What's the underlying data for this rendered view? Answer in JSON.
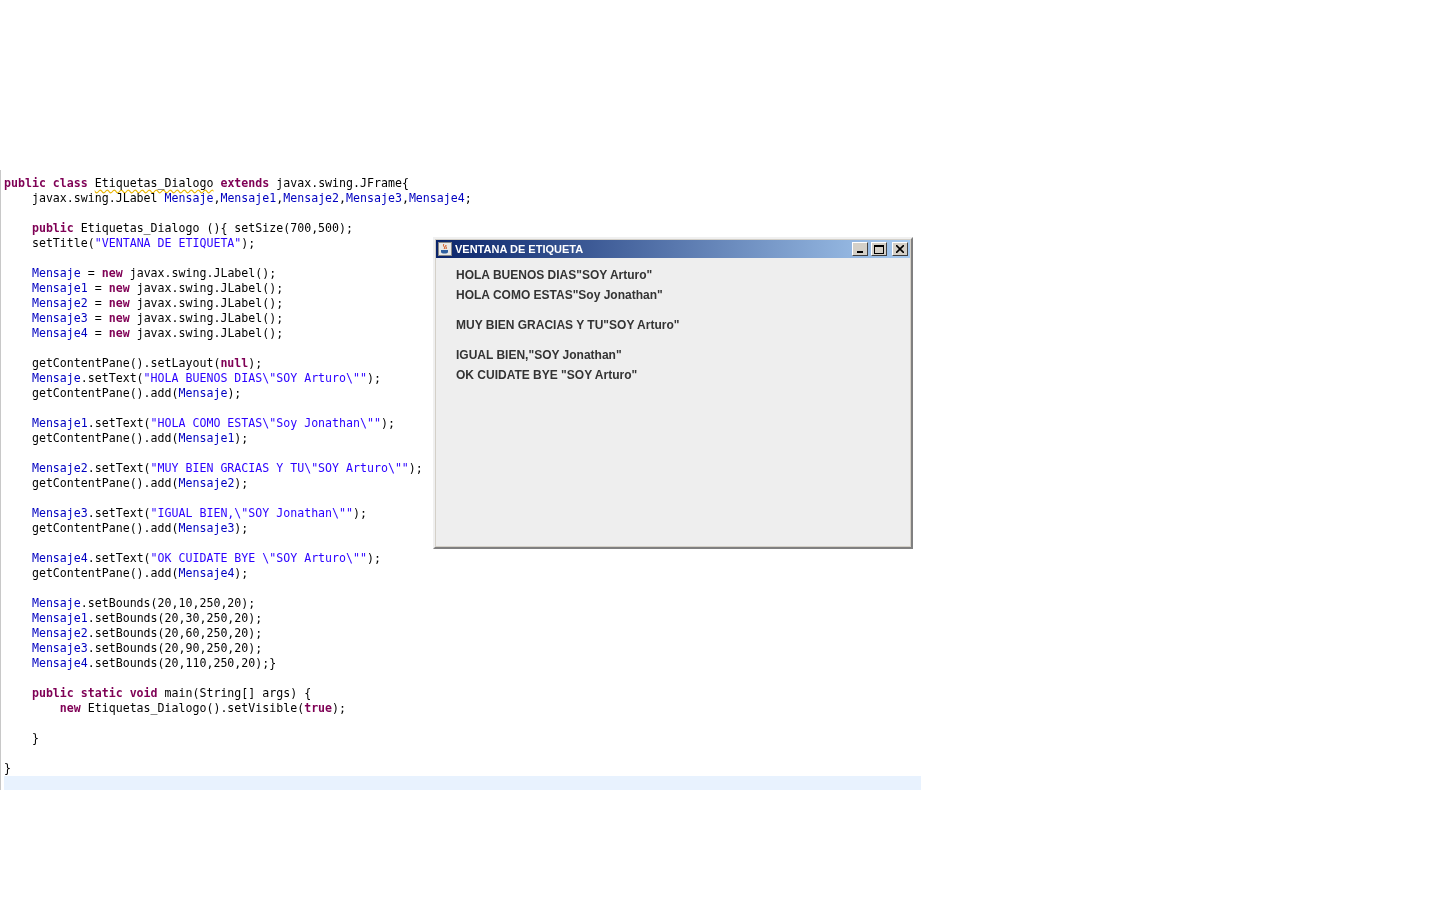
{
  "editor": {
    "blocks": [
      {
        "lines": [
          {
            "tokens": [
              {
                "kind": "keyword",
                "text": "public class "
              },
              {
                "kind": "warning",
                "text": "Etiquetas_Dialogo"
              },
              {
                "kind": "keyword",
                "text": " extends"
              },
              {
                "kind": "plain",
                "text": " javax.swing.JFrame{"
              }
            ]
          },
          {
            "tokens": [
              {
                "kind": "plain",
                "text": "    javax.swing.JLabel "
              },
              {
                "kind": "field",
                "text": "Mensaje"
              },
              {
                "kind": "plain",
                "text": ","
              },
              {
                "kind": "field",
                "text": "Mensaje1"
              },
              {
                "kind": "plain",
                "text": ","
              },
              {
                "kind": "field",
                "text": "Mensaje2"
              },
              {
                "kind": "plain",
                "text": ","
              },
              {
                "kind": "field",
                "text": "Mensaje3"
              },
              {
                "kind": "plain",
                "text": ","
              },
              {
                "kind": "field",
                "text": "Mensaje4"
              },
              {
                "kind": "plain",
                "text": ";"
              }
            ]
          }
        ]
      },
      {
        "lines": [
          {
            "tokens": [
              {
                "kind": "keyword",
                "text": "    public"
              },
              {
                "kind": "plain",
                "text": " Etiquetas_Dialogo (){ setSize(700,500);"
              }
            ]
          },
          {
            "tokens": [
              {
                "kind": "plain",
                "text": "    setTitle("
              },
              {
                "kind": "string",
                "text": "\"VENTANA DE ETIQUETA\""
              },
              {
                "kind": "plain",
                "text": ");"
              }
            ]
          }
        ]
      },
      {
        "lines": [
          {
            "tokens": [
              {
                "kind": "field",
                "text": "    Mensaje"
              },
              {
                "kind": "plain",
                "text": " = "
              },
              {
                "kind": "keyword",
                "text": "new"
              },
              {
                "kind": "plain",
                "text": " javax.swing.JLabel();"
              }
            ]
          },
          {
            "tokens": [
              {
                "kind": "field",
                "text": "    Mensaje1"
              },
              {
                "kind": "plain",
                "text": " = "
              },
              {
                "kind": "keyword",
                "text": "new"
              },
              {
                "kind": "plain",
                "text": " javax.swing.JLabel();"
              }
            ]
          },
          {
            "tokens": [
              {
                "kind": "field",
                "text": "    Mensaje2"
              },
              {
                "kind": "plain",
                "text": " = "
              },
              {
                "kind": "keyword",
                "text": "new"
              },
              {
                "kind": "plain",
                "text": " javax.swing.JLabel();"
              }
            ]
          },
          {
            "tokens": [
              {
                "kind": "field",
                "text": "    Mensaje3"
              },
              {
                "kind": "plain",
                "text": " = "
              },
              {
                "kind": "keyword",
                "text": "new"
              },
              {
                "kind": "plain",
                "text": " javax.swing.JLabel();"
              }
            ]
          },
          {
            "tokens": [
              {
                "kind": "field",
                "text": "    Mensaje4"
              },
              {
                "kind": "plain",
                "text": " = "
              },
              {
                "kind": "keyword",
                "text": "new"
              },
              {
                "kind": "plain",
                "text": " javax.swing.JLabel();"
              }
            ]
          }
        ]
      },
      {
        "lines": [
          {
            "tokens": [
              {
                "kind": "plain",
                "text": "    getContentPane().setLayout("
              },
              {
                "kind": "keyword",
                "text": "null"
              },
              {
                "kind": "plain",
                "text": ");"
              }
            ]
          },
          {
            "tokens": [
              {
                "kind": "field",
                "text": "    Mensaje"
              },
              {
                "kind": "plain",
                "text": ".setText("
              },
              {
                "kind": "string",
                "text": "\"HOLA BUENOS DIAS\\\"SOY Arturo\\\"\""
              },
              {
                "kind": "plain",
                "text": ");"
              }
            ]
          },
          {
            "tokens": [
              {
                "kind": "plain",
                "text": "    getContentPane().add("
              },
              {
                "kind": "field",
                "text": "Mensaje"
              },
              {
                "kind": "plain",
                "text": ");"
              }
            ]
          }
        ]
      },
      {
        "lines": [
          {
            "tokens": [
              {
                "kind": "field",
                "text": "    Mensaje1"
              },
              {
                "kind": "plain",
                "text": ".setText("
              },
              {
                "kind": "string",
                "text": "\"HOLA COMO ESTAS\\\"Soy Jonathan\\\"\""
              },
              {
                "kind": "plain",
                "text": ");"
              }
            ]
          },
          {
            "tokens": [
              {
                "kind": "plain",
                "text": "    getContentPane().add("
              },
              {
                "kind": "field",
                "text": "Mensaje1"
              },
              {
                "kind": "plain",
                "text": ");"
              }
            ]
          }
        ]
      },
      {
        "lines": [
          {
            "tokens": [
              {
                "kind": "field",
                "text": "    Mensaje2"
              },
              {
                "kind": "plain",
                "text": ".setText("
              },
              {
                "kind": "string",
                "text": "\"MUY BIEN GRACIAS Y TU\\\"SOY Arturo\\\"\""
              },
              {
                "kind": "plain",
                "text": ");"
              }
            ]
          },
          {
            "tokens": [
              {
                "kind": "plain",
                "text": "    getContentPane().add("
              },
              {
                "kind": "field",
                "text": "Mensaje2"
              },
              {
                "kind": "plain",
                "text": ");"
              }
            ]
          }
        ]
      },
      {
        "lines": [
          {
            "tokens": [
              {
                "kind": "field",
                "text": "    Mensaje3"
              },
              {
                "kind": "plain",
                "text": ".setText("
              },
              {
                "kind": "string",
                "text": "\"IGUAL BIEN,\\\"SOY Jonathan\\\"\""
              },
              {
                "kind": "plain",
                "text": ");"
              }
            ]
          },
          {
            "tokens": [
              {
                "kind": "plain",
                "text": "    getContentPane().add("
              },
              {
                "kind": "field",
                "text": "Mensaje3"
              },
              {
                "kind": "plain",
                "text": ");"
              }
            ]
          }
        ]
      },
      {
        "lines": [
          {
            "tokens": [
              {
                "kind": "field",
                "text": "    Mensaje4"
              },
              {
                "kind": "plain",
                "text": ".setText("
              },
              {
                "kind": "string",
                "text": "\"OK CUIDATE BYE \\\"SOY Arturo\\\"\""
              },
              {
                "kind": "plain",
                "text": ");"
              }
            ]
          },
          {
            "tokens": [
              {
                "kind": "plain",
                "text": "    getContentPane().add("
              },
              {
                "kind": "field",
                "text": "Mensaje4"
              },
              {
                "kind": "plain",
                "text": ");"
              }
            ]
          }
        ]
      },
      {
        "lines": [
          {
            "tokens": [
              {
                "kind": "field",
                "text": "    Mensaje"
              },
              {
                "kind": "plain",
                "text": ".setBounds(20,10,250,20);"
              }
            ]
          },
          {
            "tokens": [
              {
                "kind": "field",
                "text": "    Mensaje1"
              },
              {
                "kind": "plain",
                "text": ".setBounds(20,30,250,20);"
              }
            ]
          },
          {
            "tokens": [
              {
                "kind": "field",
                "text": "    Mensaje2"
              },
              {
                "kind": "plain",
                "text": ".setBounds(20,60,250,20);"
              }
            ]
          },
          {
            "tokens": [
              {
                "kind": "field",
                "text": "    Mensaje3"
              },
              {
                "kind": "plain",
                "text": ".setBounds(20,90,250,20);"
              }
            ]
          },
          {
            "tokens": [
              {
                "kind": "field",
                "text": "    Mensaje4"
              },
              {
                "kind": "plain",
                "text": ".setBounds(20,110,250,20);}"
              }
            ]
          }
        ]
      },
      {
        "lines": [
          {
            "tokens": [
              {
                "kind": "keyword",
                "text": "    public static void"
              },
              {
                "kind": "plain",
                "text": " main(String[] args) {"
              }
            ]
          },
          {
            "tokens": [
              {
                "kind": "keyword",
                "text": "        new"
              },
              {
                "kind": "plain",
                "text": " Etiquetas_Dialogo().setVisible("
              },
              {
                "kind": "keyword",
                "text": "true"
              },
              {
                "kind": "plain",
                "text": ");"
              }
            ]
          }
        ]
      },
      {
        "lines": [
          {
            "tokens": [
              {
                "kind": "plain",
                "text": "    }"
              }
            ]
          }
        ]
      },
      {
        "lines": [
          {
            "tokens": [
              {
                "kind": "plain",
                "text": "}"
              }
            ]
          }
        ]
      }
    ]
  },
  "window": {
    "title": "VENTANA DE ETIQUETA",
    "groups": [
      {
        "labels": [
          "HOLA BUENOS DIAS\"SOY Arturo\"",
          "HOLA COMO ESTAS\"Soy Jonathan\""
        ]
      },
      {
        "labels": [
          "MUY BIEN GRACIAS Y TU\"SOY Arturo\""
        ]
      },
      {
        "labels": [
          "IGUAL BIEN,\"SOY Jonathan\"",
          "OK CUIDATE BYE \"SOY Arturo\""
        ]
      }
    ]
  }
}
